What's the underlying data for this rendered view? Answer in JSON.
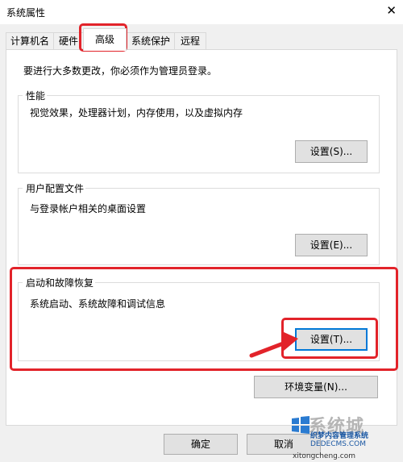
{
  "window": {
    "title": "系统属性"
  },
  "tabs": [
    {
      "label": "计算机名"
    },
    {
      "label": "硬件"
    },
    {
      "label": "高级",
      "active": true
    },
    {
      "label": "系统保护"
    },
    {
      "label": "远程"
    }
  ],
  "notice": "要进行大多数更改，你必须作为管理员登录。",
  "performance": {
    "title": "性能",
    "description": "视觉效果，处理器计划，内存使用，以及虚拟内存",
    "button": "设置(S)..."
  },
  "user_profiles": {
    "title": "用户配置文件",
    "description": "与登录帐户相关的桌面设置",
    "button": "设置(E)..."
  },
  "startup_recovery": {
    "title": "启动和故障恢复",
    "description": "系统启动、系统故障和调试信息",
    "button": "设置(T)..."
  },
  "env_button": "环境变量(N)...",
  "footer": {
    "ok": "确定",
    "cancel": "取消"
  },
  "watermark": {
    "brand": "系统城",
    "line1": "织梦内容管理系统",
    "line2": "DEDECMS.COM",
    "line3": "xitongcheng.com"
  },
  "annotation_color": "#e2232a",
  "accent_color": "#0078d7"
}
